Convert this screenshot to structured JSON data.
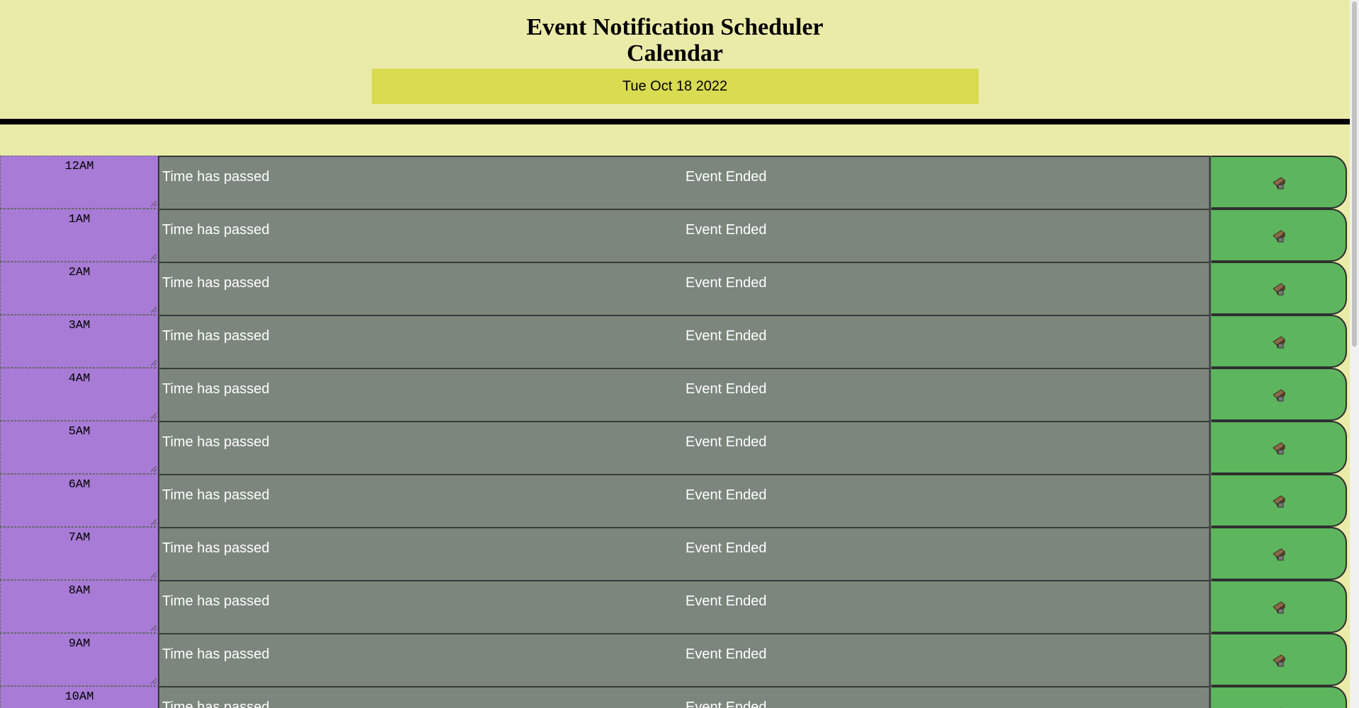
{
  "header": {
    "title_line1": "Event Notification Scheduler",
    "title_line2": "Calendar",
    "current_day": "Tue Oct 18 2022"
  },
  "colors": {
    "background": "#ebeba9",
    "date_bar": "#d9db50",
    "hour_block": "#a77bd6",
    "past_block": "#7c867d",
    "save_button": "#5db55d"
  },
  "timeblocks": [
    {
      "hour": "12AM",
      "status_text": "Time has passed",
      "event_text": "Event Ended",
      "save_icon": "save-icon"
    },
    {
      "hour": "1AM",
      "status_text": "Time has passed",
      "event_text": "Event Ended",
      "save_icon": "save-icon"
    },
    {
      "hour": "2AM",
      "status_text": "Time has passed",
      "event_text": "Event Ended",
      "save_icon": "save-icon"
    },
    {
      "hour": "3AM",
      "status_text": "Time has passed",
      "event_text": "Event Ended",
      "save_icon": "save-icon"
    },
    {
      "hour": "4AM",
      "status_text": "Time has passed",
      "event_text": "Event Ended",
      "save_icon": "save-icon"
    },
    {
      "hour": "5AM",
      "status_text": "Time has passed",
      "event_text": "Event Ended",
      "save_icon": "save-icon"
    },
    {
      "hour": "6AM",
      "status_text": "Time has passed",
      "event_text": "Event Ended",
      "save_icon": "save-icon"
    },
    {
      "hour": "7AM",
      "status_text": "Time has passed",
      "event_text": "Event Ended",
      "save_icon": "save-icon"
    },
    {
      "hour": "8AM",
      "status_text": "Time has passed",
      "event_text": "Event Ended",
      "save_icon": "save-icon"
    },
    {
      "hour": "9AM",
      "status_text": "Time has passed",
      "event_text": "Event Ended",
      "save_icon": "save-icon"
    },
    {
      "hour": "10AM",
      "status_text": "Time has passed",
      "event_text": "Event Ended",
      "save_icon": "save-icon"
    }
  ]
}
